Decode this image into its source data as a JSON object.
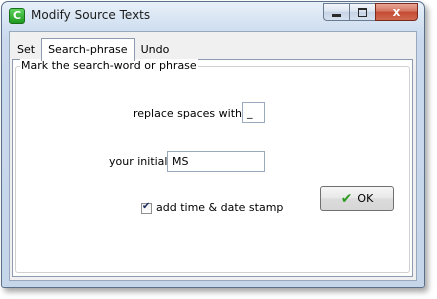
{
  "window": {
    "title": "Modify Source Texts",
    "app_icon_letter": "C",
    "close_glyph": "x",
    "icons": [
      "app-icon",
      "minimize-icon",
      "maximize-icon",
      "close-icon"
    ]
  },
  "tabs": [
    {
      "label": "Set",
      "active": false
    },
    {
      "label": "Search-phrase",
      "active": true
    },
    {
      "label": "Undo",
      "active": false
    }
  ],
  "group": {
    "legend": "Mark the search-word or phrase"
  },
  "fields": {
    "replace_spaces_label": "replace spaces with",
    "replace_spaces_value": "_",
    "initials_label": "your initials",
    "initials_value": "MS"
  },
  "stamp": {
    "label": "add time & date stamp",
    "checked": true,
    "check_glyph": "✔"
  },
  "ok_button": {
    "label": "OK",
    "icon": "checkmark-icon",
    "icon_glyph": "✔"
  },
  "colors": {
    "accent_check": "#2e9b21",
    "close_button": "#c34a32"
  }
}
